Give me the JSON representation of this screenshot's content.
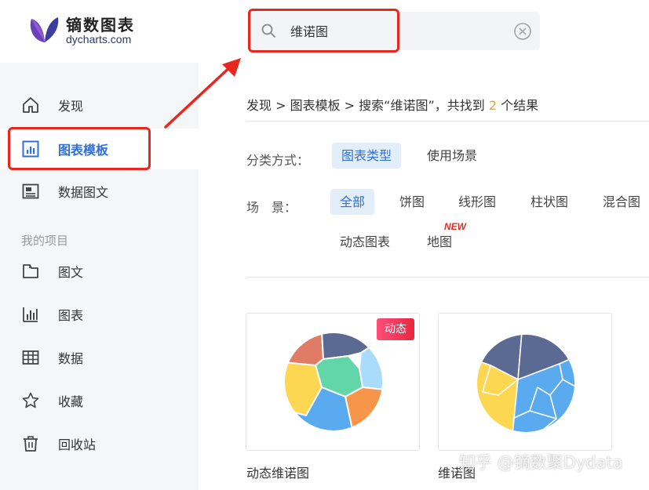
{
  "header": {
    "logo_cn": "镝数图表",
    "logo_en": "dycharts.com",
    "search": {
      "value": "维诺图",
      "placeholder": ""
    }
  },
  "sidebar": {
    "items": [
      {
        "label": "发现",
        "icon": "home-icon"
      },
      {
        "label": "图表模板",
        "icon": "bar-chart-icon",
        "active": true
      },
      {
        "label": "数据图文",
        "icon": "article-icon"
      }
    ],
    "section_title": "我的项目",
    "project_items": [
      {
        "label": "图文",
        "icon": "folder-icon"
      },
      {
        "label": "图表",
        "icon": "chart-icon"
      },
      {
        "label": "数据",
        "icon": "table-icon"
      },
      {
        "label": "收藏",
        "icon": "star-icon"
      },
      {
        "label": "回收站",
        "icon": "trash-icon"
      }
    ]
  },
  "breadcrumb": {
    "prefix": "发现 > 图表模板 > 搜索“维诺图”，共找到 ",
    "count": "2",
    "suffix": " 个结果"
  },
  "filters": {
    "classify_label": "分类方式：",
    "classify_options": [
      "图表类型",
      "使用场景"
    ],
    "scene_label": "场　景：",
    "scene_options": [
      "全部",
      "饼图",
      "线形图",
      "柱状图",
      "混合图",
      "动态图表",
      "地图"
    ],
    "new_badge": "NEW"
  },
  "results": [
    {
      "title": "动态维诺图",
      "badge": "动态"
    },
    {
      "title": "维诺图"
    }
  ],
  "watermark": "知乎 @镝数聚Dydata",
  "colors": {
    "accent": "#2f6fd8",
    "highlight_red": "#e8271f",
    "count_orange": "#e6a23c"
  }
}
